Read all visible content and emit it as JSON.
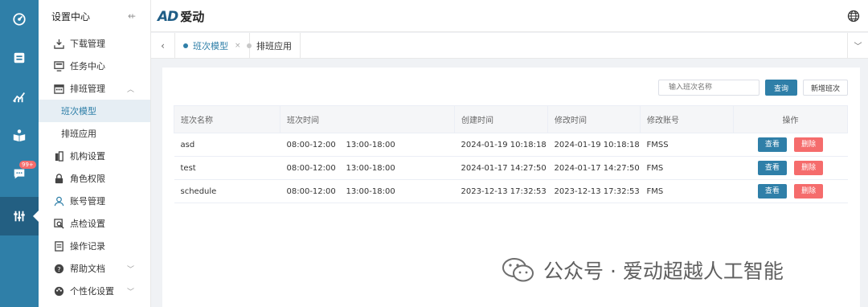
{
  "rail": {
    "items": [
      {
        "icon": "dashboard-icon"
      },
      {
        "icon": "inbox-icon"
      },
      {
        "icon": "chart-icon"
      },
      {
        "icon": "book-icon"
      },
      {
        "icon": "message-icon",
        "badge": "99+"
      },
      {
        "icon": "sliders-icon",
        "active": true
      }
    ]
  },
  "menu": {
    "title": "设置中心",
    "collapse_icon": "collapse-left-icon",
    "items": [
      {
        "label": "下载管理",
        "icon": "download-icon"
      },
      {
        "label": "任务中心",
        "icon": "monitor-icon"
      },
      {
        "label": "排班管理",
        "icon": "calendar-icon",
        "expanded": true
      },
      {
        "label": "机构设置",
        "icon": "building-icon"
      },
      {
        "label": "角色权限",
        "icon": "lock-icon"
      },
      {
        "label": "账号管理",
        "icon": "user-icon"
      },
      {
        "label": "点检设置",
        "icon": "inspect-icon"
      },
      {
        "label": "操作记录",
        "icon": "log-icon"
      },
      {
        "label": "帮助文档",
        "icon": "help-icon"
      },
      {
        "label": "个性化设置",
        "icon": "palette-icon"
      }
    ],
    "sub_items": [
      {
        "label": "班次模型",
        "active": true
      },
      {
        "label": "排班应用",
        "active": false
      }
    ]
  },
  "header": {
    "logo_mark": "AD",
    "logo_text": "爱动"
  },
  "tabs": [
    {
      "label": "班次模型",
      "active": true,
      "close": "×"
    },
    {
      "label": "排班应用",
      "active": false
    }
  ],
  "toolbar": {
    "search_placeholder": "输入班次名称",
    "query_label": "查询",
    "add_label": "新增班次"
  },
  "table": {
    "columns": [
      "班次名称",
      "班次时间",
      "创建时间",
      "修改时间",
      "修改账号",
      "操作"
    ],
    "rows": [
      {
        "name": "asd",
        "time": "08:00-12:00    13:00-18:00",
        "created": "2024-01-19 10:18:18",
        "modified": "2024-01-19 10:18:18",
        "account": "FMSS"
      },
      {
        "name": "test",
        "time": "08:00-12:00    13:00-18:00",
        "created": "2024-01-17 14:27:50",
        "modified": "2024-01-17 14:27:50",
        "account": "FMS"
      },
      {
        "name": "schedule",
        "time": "08:00-12:00    13:00-18:00",
        "created": "2023-12-13 17:32:53",
        "modified": "2023-12-13 17:32:53",
        "account": "FMS"
      }
    ],
    "view_label": "查看",
    "delete_label": "删除"
  },
  "watermark": {
    "text": "公众号 · 爱动超越人工智能"
  },
  "colors": {
    "primary": "#2f7fa8",
    "rail_active": "#235f82",
    "danger": "#f56c6c"
  }
}
